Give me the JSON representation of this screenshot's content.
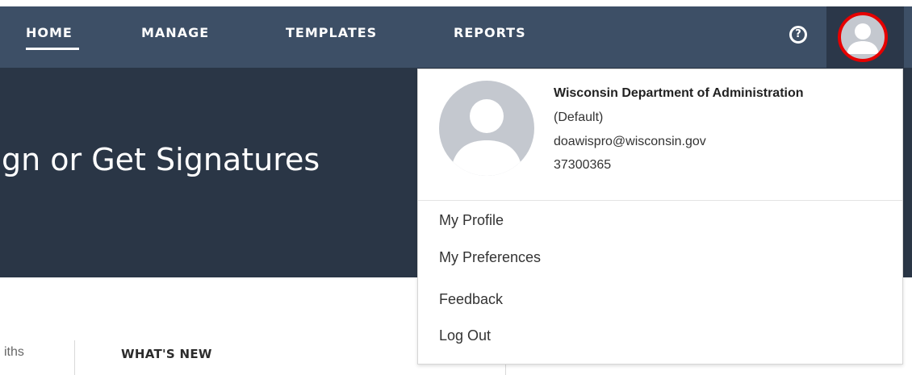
{
  "nav": {
    "tabs": [
      {
        "label": "HOME",
        "active": true
      },
      {
        "label": "MANAGE"
      },
      {
        "label": "TEMPLATES"
      },
      {
        "label": "REPORTS"
      }
    ],
    "help_label": "?"
  },
  "hero": {
    "title": "gn or Get Signatures"
  },
  "lower": {
    "months_label": "iths",
    "whats_new": "WHAT'S NEW"
  },
  "account_menu": {
    "org": "Wisconsin Department of Administration",
    "default": "(Default)",
    "email": "doawispro@wisconsin.gov",
    "account_id": "37300365",
    "items": [
      {
        "label": "My Profile"
      },
      {
        "label": "My Preferences"
      },
      {
        "label": "Feedback"
      },
      {
        "label": "Log Out"
      }
    ]
  },
  "icons": {
    "help": "help-circle-icon",
    "avatar": "user-avatar-icon"
  },
  "colors": {
    "nav_bg": "#3d4f66",
    "hero_bg": "#2a3646",
    "avatar_highlight": "#e60000",
    "avatar_fill": "#c4c8cf"
  }
}
